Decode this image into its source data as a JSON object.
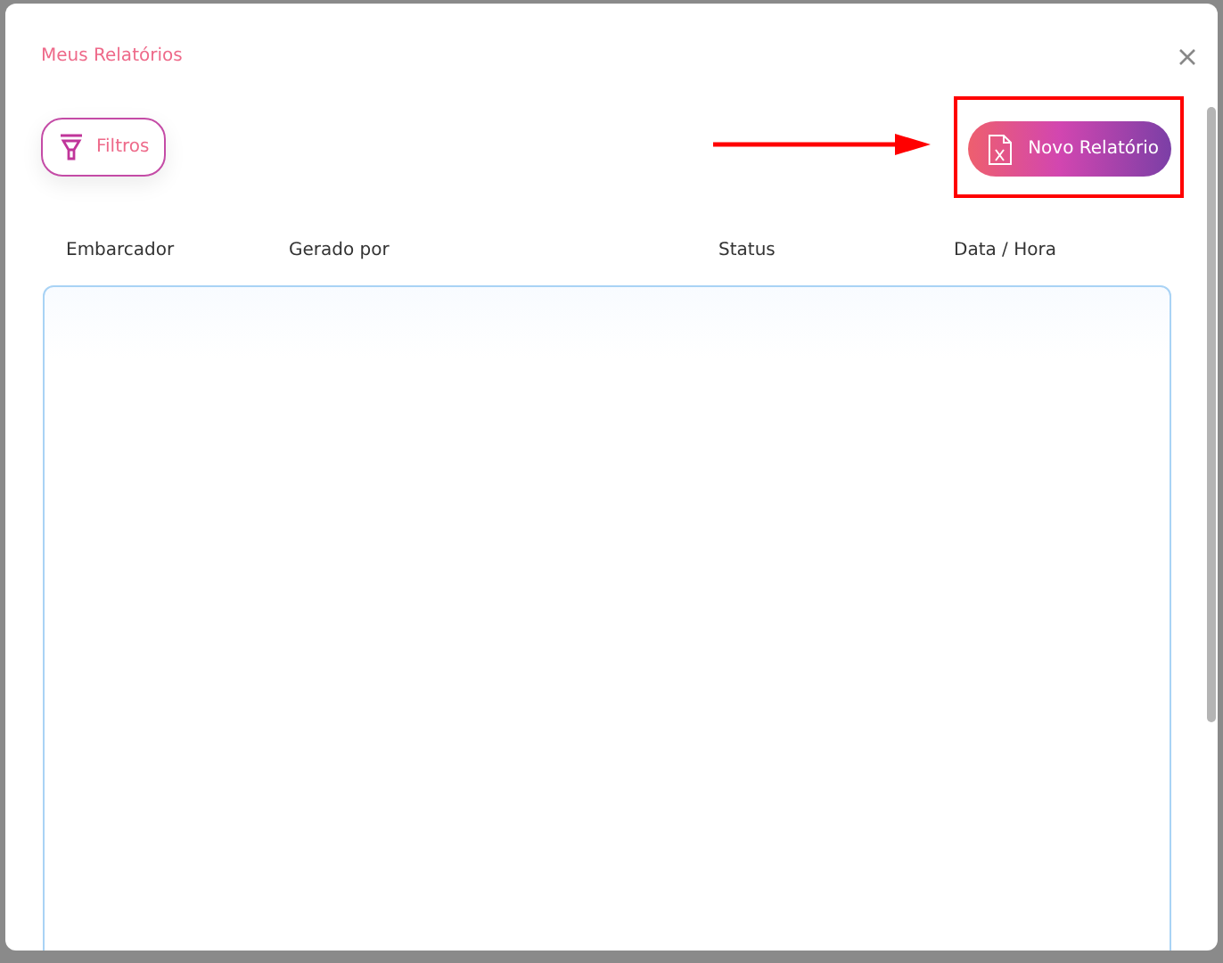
{
  "dialog": {
    "title": "Meus Relatórios"
  },
  "toolbar": {
    "filter_button": "Filtros",
    "new_report_button": "Novo Relatório",
    "annotation": {
      "kind": "highlight_arrow"
    }
  },
  "table": {
    "columns": [
      "Embarcador",
      "Gerado por",
      "Status",
      "Data / Hora"
    ]
  }
}
